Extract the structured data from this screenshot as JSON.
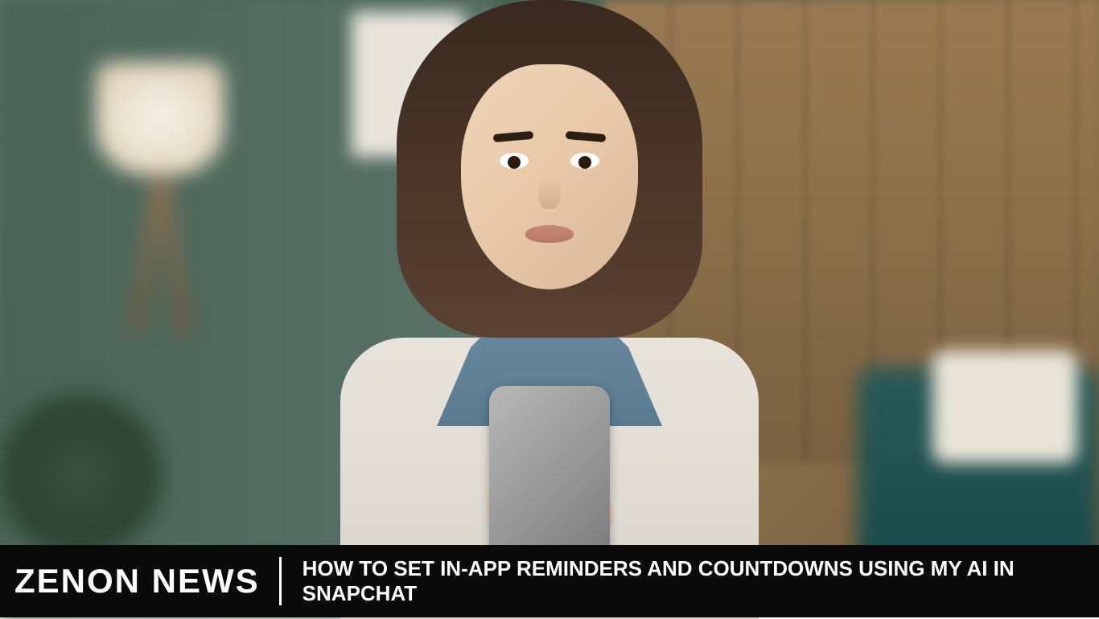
{
  "banner": {
    "brand": "ZENON NEWS",
    "title": "HOW TO SET IN-APP REMINDERS AND COUNTDOWNS USING MY AI IN SNAPCHAT"
  }
}
